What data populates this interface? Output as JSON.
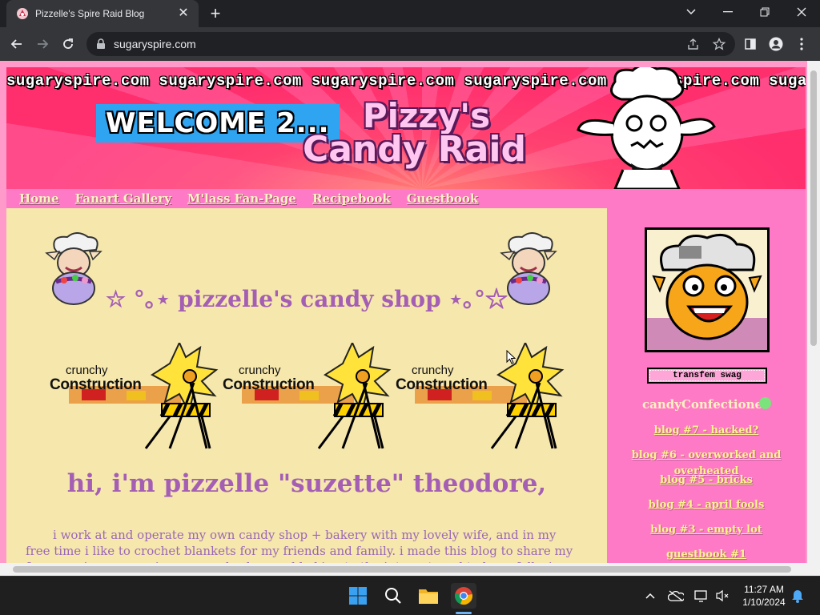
{
  "browser": {
    "tab_title": "Pizzelle's Spire Raid Blog",
    "url": "sugaryspire.com"
  },
  "page": {
    "ticker_text": "sugaryspire.com sugaryspire.com sugaryspire.com sugaryspire.com sugaryspire.com sugaryspire.com",
    "welcome_text": "WELCOME 2...",
    "logo_line1": "Pizzy's",
    "logo_line2": "Candy Raid",
    "nav": [
      "Home",
      "Fanart Gallery",
      "M'lass Fan-Page",
      "Recipebook",
      "Guestbook"
    ],
    "shop_title": "☆ °｡⋆ pizzelle's candy shop ⋆｡°☆",
    "construction_small": "crunchy",
    "construction_big": "Construction",
    "hi_title": "hi, i'm pizzelle \"suzette\" theodore,",
    "intro_text": "i work at and operate my own candy shop + bakery with my lovely wife, and in my free time i like to crochet blankets for my friends and family. i made this blog to share my fun experiences running my candy shop and baking to the internet, and to keep folks in the loop!"
  },
  "sidebar": {
    "tagline": "transfem swag",
    "username": "candyConfectioner",
    "status_color": "#7be37b",
    "blog_links": [
      "blog #7 - hacked?",
      "blog #6 - overworked and overheated",
      "blog #5 - bricks",
      "blog #4 - april fools",
      "blog #3 - empty lot",
      "guestbook #1"
    ]
  },
  "taskbar": {
    "time": "11:27 AM",
    "date": "1/10/2024"
  },
  "colors": {
    "main_bg": "#f6e7ad",
    "side_bg": "#ff7ac6",
    "title_purple": "#a45fb4",
    "link_yellow": "#fff58a"
  }
}
